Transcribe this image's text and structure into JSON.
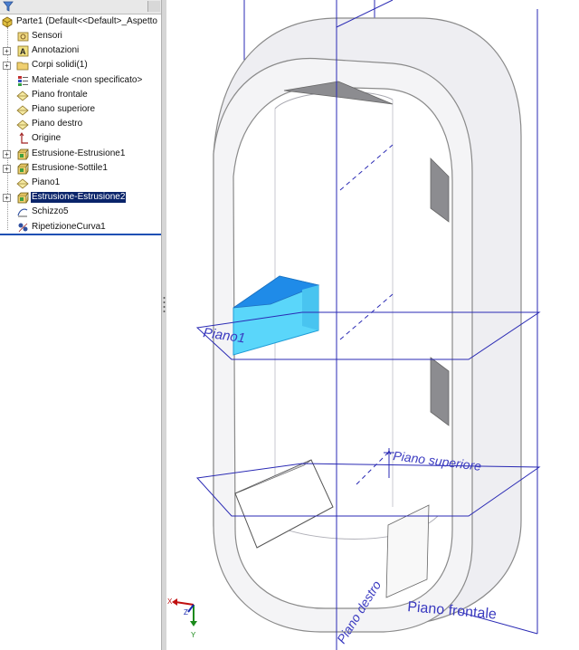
{
  "feature_tree": {
    "root_label": "Parte1  (Default<<Default>_Aspetto",
    "items": [
      {
        "label": "Sensori",
        "icon": "sensor-folder-icon",
        "expandable": false,
        "selected": false
      },
      {
        "label": "Annotazioni",
        "icon": "annotation-icon",
        "expandable": true,
        "selected": false
      },
      {
        "label": "Corpi solidi(1)",
        "icon": "solid-bodies-folder-icon",
        "expandable": true,
        "selected": false
      },
      {
        "label": "Materiale <non specificato>",
        "icon": "material-icon",
        "expandable": false,
        "selected": false
      },
      {
        "label": "Piano frontale",
        "icon": "plane-icon",
        "expandable": false,
        "selected": false
      },
      {
        "label": "Piano superiore",
        "icon": "plane-icon",
        "expandable": false,
        "selected": false
      },
      {
        "label": "Piano destro",
        "icon": "plane-icon",
        "expandable": false,
        "selected": false
      },
      {
        "label": "Origine",
        "icon": "origin-icon",
        "expandable": false,
        "selected": false
      },
      {
        "label": "Estrusione-Estrusione1",
        "icon": "extrude-icon",
        "expandable": true,
        "selected": false
      },
      {
        "label": "Estrusione-Sottile1",
        "icon": "extrude-icon",
        "expandable": true,
        "selected": false
      },
      {
        "label": "Piano1",
        "icon": "plane-icon",
        "expandable": false,
        "selected": false
      },
      {
        "label": "Estrusione-Estrusione2",
        "icon": "extrude-icon",
        "expandable": true,
        "selected": true
      },
      {
        "label": "Schizzo5",
        "icon": "sketch-icon",
        "expandable": false,
        "selected": false
      },
      {
        "label": "RipetizioneCurva1",
        "icon": "curve-pattern-icon",
        "expandable": false,
        "selected": false
      }
    ]
  },
  "viewport": {
    "plane_labels": {
      "plane1": "Piano1",
      "top": "Piano superiore",
      "front": "Piano frontale",
      "right": "Piano destro"
    },
    "triad": {
      "x": "X",
      "y": "Y",
      "z": "Z"
    },
    "colors": {
      "plane_outline": "#2a2ab4",
      "plane_label": "#3a3ac0",
      "part_fill": "#eeeef2",
      "part_edge": "#8a8a8a",
      "selected_feature": "#5ad6fa",
      "selection_blue": "#0a246a"
    }
  }
}
